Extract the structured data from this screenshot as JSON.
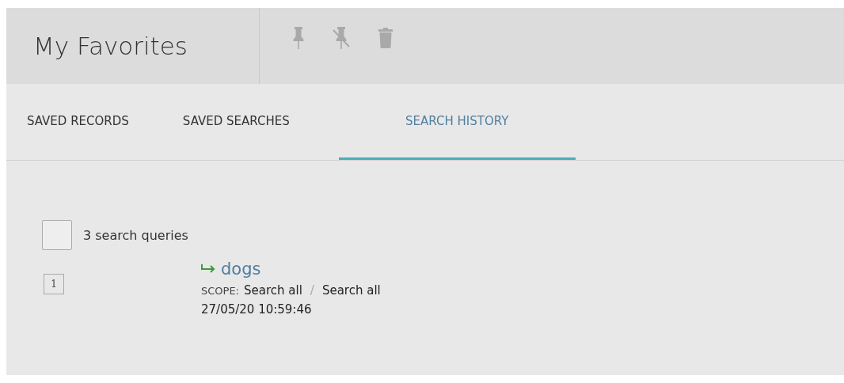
{
  "header": {
    "title": "My Favorites"
  },
  "tabs": [
    {
      "label": "SAVED RECORDS",
      "selected": false
    },
    {
      "label": "SAVED SEARCHES",
      "selected": false
    },
    {
      "label": "SEARCH HISTORY",
      "selected": true
    }
  ],
  "results": {
    "select_all": {
      "checked": false
    },
    "count": "3 search queries",
    "items": [
      {
        "index": "1",
        "query": "dogs",
        "scope_label": "SCOPE:",
        "scope": "Search all",
        "separator": "/",
        "scope_2": "Search all",
        "timestamp": "27/05/20 10:59:46"
      }
    ]
  }
}
